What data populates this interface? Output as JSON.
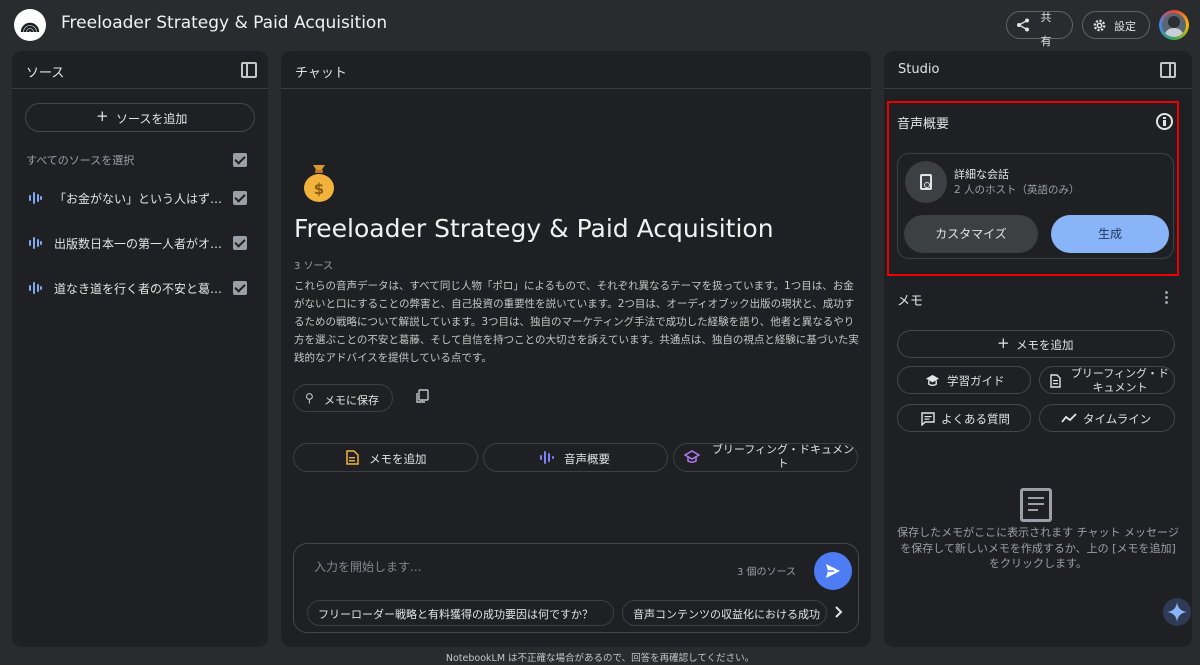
{
  "header": {
    "title": "Freeloader Strategy & Paid Acquisition",
    "share_label": "共有",
    "settings_label": "設定"
  },
  "sources": {
    "panel_title": "ソース",
    "add_label": "ソースを追加",
    "select_all_label": "すべてのソースを選択",
    "items": [
      {
        "title": "「お金がない」という人はずっと…"
      },
      {
        "title": "出版数日本一の第一人者がオーディオ…"
      },
      {
        "title": "道なき道を行く者の不安と葛藤…"
      }
    ]
  },
  "chat": {
    "panel_title": "チャット",
    "notebook_title": "Freeloader Strategy & Paid Acquisition",
    "source_count": "3 ソース",
    "summary": "これらの音声データは、すべて同じ人物「ポロ」によるもので、それぞれ異なるテーマを扱っています。1つ目は、お金がないと口にすることの弊害と、自己投資の重要性を説いています。2つ目は、オーディオブック出版の現状と、成功するための戦略について解説しています。3つ目は、独自のマーケティング手法で成功した経験を語り、他者と異なるやり方を選ぶことの不安と葛藤、そして自信を持つことの大切さを訴えています。共通点は、独自の視点と経験に基づいた実践的なアドバイスを提供している点です。",
    "save_memo_label": "メモに保存",
    "actions": [
      {
        "label": "メモを追加",
        "icon": "note-icon"
      },
      {
        "label": "音声概要",
        "icon": "audio-wave-icon"
      },
      {
        "label": "ブリーフィング・ドキュメント",
        "icon": "graduation-cap-icon"
      }
    ],
    "input_placeholder": "入力を開始します...",
    "input_source_count": "3 個のソース",
    "suggestions": [
      "フリーローダー戦略と有料獲得の成功要因は何ですか？",
      "音声コンテンツの収益化における成功"
    ]
  },
  "studio": {
    "panel_title": "Studio",
    "audio_overview_title": "音声概要",
    "conversation_title": "詳細な会話",
    "conversation_sub": "2 人のホスト（英語のみ）",
    "customize_label": "カスタマイズ",
    "generate_label": "生成",
    "memo_title": "メモ",
    "add_memo_label": "メモを追加",
    "study_guide_label": "学習ガイド",
    "briefing_doc_label": "ブリーフィング・ドキュメント",
    "faq_label": "よくある質問",
    "timeline_label": "タイムライン",
    "empty_text": "保存したメモがここに表示されます チャット メッセージを保存して新しいメモを作成するか、上の [メモを追加] をクリックします。"
  },
  "footer": {
    "note": "NotebookLM は不正確な場合があるので、回答を再確認してください。"
  },
  "colors": {
    "accent_blue": "#8ab4f8",
    "send_blue": "#4d7cf5",
    "highlight_red": "#e00000",
    "wave_blue": "#7fa8f0"
  }
}
